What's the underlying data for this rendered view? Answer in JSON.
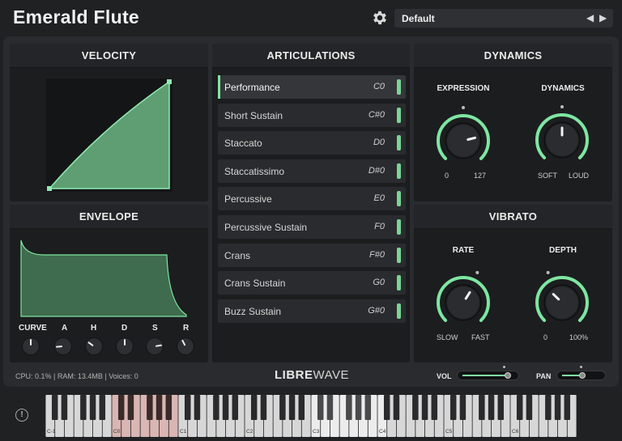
{
  "header": {
    "title": "Emerald Flute",
    "preset": "Default",
    "prev_arrow": "◀",
    "next_arrow": "▶"
  },
  "colors": {
    "accent": "#7ee6a2",
    "panel": "#1c1d1f",
    "background": "#202123"
  },
  "velocity": {
    "title": "VELOCITY"
  },
  "envelope": {
    "title": "ENVELOPE",
    "knobs": [
      {
        "label": "CURVE",
        "value": 0.5
      },
      {
        "label": "A",
        "value": 0.15
      },
      {
        "label": "H",
        "value": 0.3
      },
      {
        "label": "D",
        "value": 0.5
      },
      {
        "label": "S",
        "value": 0.8
      },
      {
        "label": "R",
        "value": 0.4
      }
    ]
  },
  "articulations": {
    "title": "ARTICULATIONS",
    "items": [
      {
        "label": "Performance",
        "note": "C0",
        "active": true
      },
      {
        "label": "Short Sustain",
        "note": "C#0",
        "active": false
      },
      {
        "label": "Staccato",
        "note": "D0",
        "active": false
      },
      {
        "label": "Staccatissimo",
        "note": "D#0",
        "active": false
      },
      {
        "label": "Percussive",
        "note": "E0",
        "active": false
      },
      {
        "label": "Percussive Sustain",
        "note": "F0",
        "active": false
      },
      {
        "label": "Crans",
        "note": "F#0",
        "active": false
      },
      {
        "label": "Crans Sustain",
        "note": "G0",
        "active": false
      },
      {
        "label": "Buzz Sustain",
        "note": "G#0",
        "active": false
      }
    ]
  },
  "dynamics": {
    "title": "DYNAMICS",
    "expression": {
      "label": "EXPRESSION",
      "min": "0",
      "max": "127",
      "value": 0.78
    },
    "dynamics": {
      "label": "DYNAMICS",
      "min": "SOFT",
      "max": "LOUD",
      "value": 0.5
    }
  },
  "vibrato": {
    "title": "VIBRATO",
    "rate": {
      "label": "RATE",
      "min": "SLOW",
      "max": "FAST",
      "value": 0.62
    },
    "depth": {
      "label": "DEPTH",
      "min": "0",
      "max": "100%",
      "value": 0.33
    }
  },
  "footer": {
    "status": "CPU: 0.1% | RAM: 13.4MB | Voices: 0",
    "logo_bold": "LIBRE",
    "logo_light": "WAVE",
    "vol_label": "VOL",
    "pan_label": "PAN",
    "vol_value": 0.88,
    "pan_value": 0.5
  },
  "keyboard": {
    "octave_labels": [
      "C-1",
      "C0",
      "C1",
      "C2",
      "C3",
      "C4",
      "C5",
      "C6",
      "C7"
    ],
    "key_info": "ⓘ"
  }
}
